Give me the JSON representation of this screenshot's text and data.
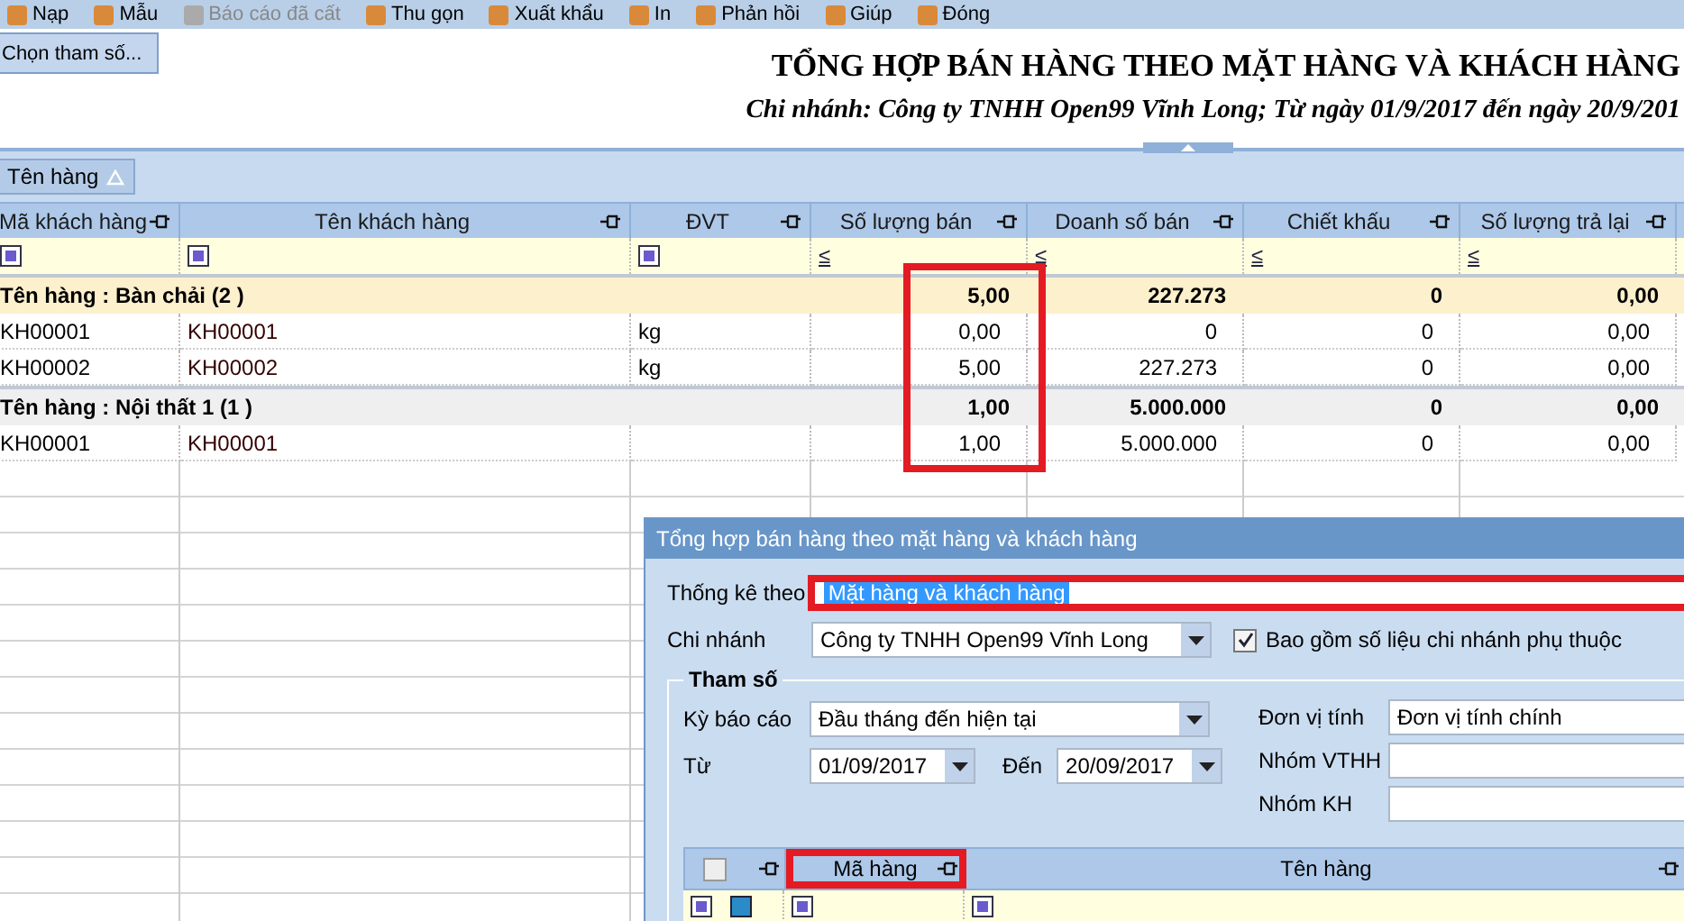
{
  "toolbar": [
    {
      "label": "Nạp",
      "disabled": false
    },
    {
      "label": "Mẫu",
      "disabled": false
    },
    {
      "label": "Báo cáo đã cất",
      "disabled": true
    },
    {
      "label": "Thu gọn",
      "disabled": false
    },
    {
      "label": "Xuất khẩu",
      "disabled": false
    },
    {
      "label": "In",
      "disabled": false
    },
    {
      "label": "Phản hồi",
      "disabled": false
    },
    {
      "label": "Giúp",
      "disabled": false
    },
    {
      "label": "Đóng",
      "disabled": false
    }
  ],
  "choose_button": "Chọn tham số...",
  "report": {
    "title": "TỔNG HỢP BÁN HÀNG THEO MẶT HÀNG VÀ KHÁCH HÀNG",
    "subtitle": "Chi nhánh: Công ty TNHH Open99 Vĩnh Long; Từ ngày 01/9/2017 đến ngày 20/9/201"
  },
  "group_by": "Tên hàng",
  "grid": {
    "columns": [
      {
        "label": "Mã khách hàng",
        "kind": "text",
        "highlighted": false
      },
      {
        "label": "Tên khách hàng",
        "kind": "text",
        "highlighted": false
      },
      {
        "label": "ĐVT",
        "kind": "text",
        "highlighted": false
      },
      {
        "label": "Số lượng bán",
        "kind": "number",
        "filter_op": "≤",
        "highlighted": true
      },
      {
        "label": "Doanh số bán",
        "kind": "number",
        "filter_op": "≤",
        "highlighted": false
      },
      {
        "label": "Chiết khấu",
        "kind": "number",
        "filter_op": "≤",
        "highlighted": false
      },
      {
        "label": "Số lượng trả lại",
        "kind": "number",
        "filter_op": "≤",
        "highlighted": false
      }
    ],
    "rows": [
      {
        "kind": "group",
        "selected": true,
        "label": "Tên hàng : Bàn chải (2 )",
        "cells": [
          "",
          "",
          "",
          "5,00",
          "227.273",
          "0",
          "0,00"
        ]
      },
      {
        "kind": "item",
        "selected": false,
        "cells": [
          "KH00001",
          "KH00001",
          "kg",
          "0,00",
          "0",
          "0",
          "0,00"
        ]
      },
      {
        "kind": "item",
        "selected": false,
        "cells": [
          "KH00002",
          "KH00002",
          "kg",
          "5,00",
          "227.273",
          "0",
          "0,00"
        ]
      },
      {
        "kind": "group",
        "selected": false,
        "label": "Tên hàng : Nội thất 1 (1 )",
        "cells": [
          "",
          "",
          "",
          "1,00",
          "5.000.000",
          "0",
          "0,00"
        ]
      },
      {
        "kind": "item",
        "selected": false,
        "cells": [
          "KH00001",
          "KH00001",
          "",
          "1,00",
          "5.000.000",
          "0",
          "0,00"
        ]
      }
    ]
  },
  "dialog": {
    "title": "Tổng hợp bán hàng theo mặt hàng và khách hàng",
    "stat_by": {
      "label": "Thống kê theo",
      "value": "Mặt hàng và khách hàng",
      "highlighted": true
    },
    "branch": {
      "label": "Chi nhánh",
      "value": "Công ty TNHH Open99 Vĩnh Long"
    },
    "include_sub": {
      "label": "Bao gồm số liệu chi nhánh phụ thuộc",
      "checked": true
    },
    "params_title": "Tham số",
    "period": {
      "label": "Kỳ báo cáo",
      "value": "Đầu tháng đến hiện tại"
    },
    "from": {
      "label": "Từ",
      "value": "01/09/2017"
    },
    "to": {
      "label": "Đến",
      "value": "20/09/2017"
    },
    "unit": {
      "label": "Đơn vị tính",
      "value": "Đơn vị tính chính"
    },
    "group_vthh": {
      "label": "Nhóm VTHH"
    },
    "group_kh": {
      "label": "Nhóm KH"
    },
    "list": {
      "select_all_checked": false,
      "columns": [
        {
          "label": "Mã hàng",
          "highlighted": true
        },
        {
          "label": "Tên hàng",
          "highlighted": false
        }
      ]
    }
  }
}
